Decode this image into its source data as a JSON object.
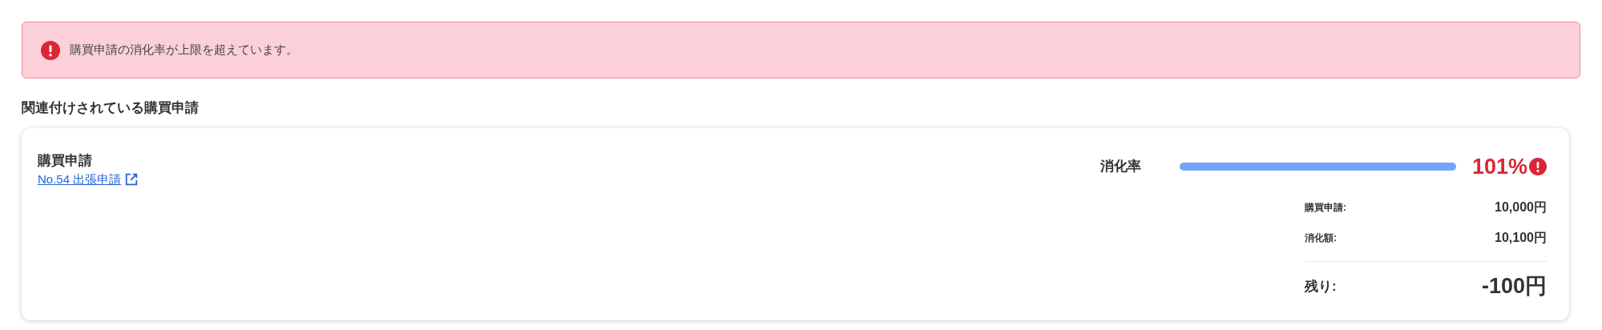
{
  "alert": {
    "kind": "error",
    "message": "購買申請の消化率が上限を超えています。"
  },
  "section_title": "関連付けされている購買申請",
  "card": {
    "title": "購買申請",
    "link": "No.54 出張申請",
    "rate_label": "消化率",
    "level": 1,
    "rate": "101%",
    "over_limit": true,
    "rows": [
      {
        "kind": "normal",
        "label": "購買申請:",
        "value": "10,000円"
      },
      {
        "kind": "normal",
        "label": "消化額:",
        "value": "10,100円"
      },
      {
        "kind": "total",
        "label": "残り:",
        "value": "-100円"
      }
    ]
  }
}
